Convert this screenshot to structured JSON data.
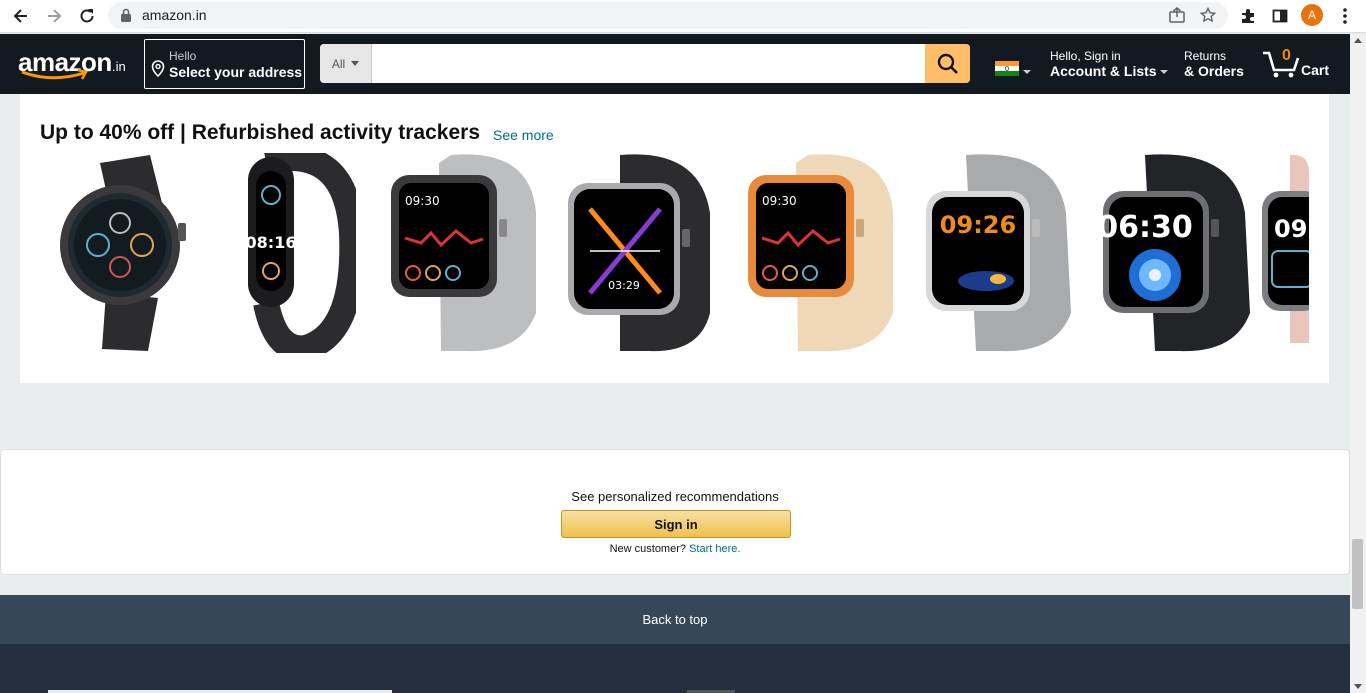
{
  "browser": {
    "url": "amazon.in",
    "profile_initial": "A",
    "icons": [
      "back-icon",
      "forward-icon",
      "reload-icon",
      "lock-icon",
      "share-icon",
      "star-icon",
      "extensions-icon",
      "side-panel-icon",
      "menu-icon"
    ]
  },
  "header": {
    "logo_text": "amazon",
    "logo_tld": ".in",
    "address_line1": "Hello",
    "address_line2": "Select your address",
    "search_category": "All",
    "search_placeholder": "",
    "account_line1": "Hello, Sign in",
    "account_line2": "Account & Lists",
    "returns_line1": "Returns",
    "returns_line2": "& Orders",
    "cart_count": "0",
    "cart_label": "Cart",
    "colors": {
      "nav_bg": "#131921",
      "search_button": "#febd69",
      "cart_count": "#f08804"
    }
  },
  "deals_card": {
    "title": "Up to 40% off | Refurbished activity trackers",
    "see_more": "See more",
    "products": [
      {
        "name": "round-smartwatch",
        "screen_time": ""
      },
      {
        "name": "fitness-band",
        "screen_time": "08:16"
      },
      {
        "name": "grey-square-watch",
        "screen_time": "09:30"
      },
      {
        "name": "black-square-watch",
        "screen_time": "03:29"
      },
      {
        "name": "beige-square-watch",
        "screen_time": "09:30"
      },
      {
        "name": "silver-grey-watch",
        "screen_time": "09:26"
      },
      {
        "name": "black-watch-flower",
        "screen_time": "06:30"
      },
      {
        "name": "pink-watch-partial",
        "screen_time": "09"
      }
    ]
  },
  "recommendations": {
    "text": "See personalized recommendations",
    "button_label": "Sign in",
    "new_customer_text": "New customer? ",
    "start_here": "Start here."
  },
  "footer": {
    "back_to_top": "Back to top"
  }
}
